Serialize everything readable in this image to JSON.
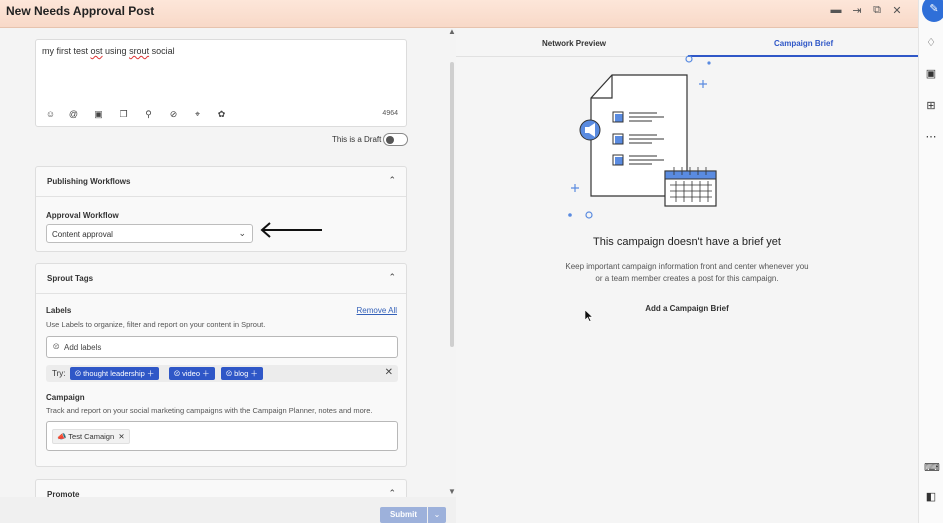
{
  "window": {
    "title": "New Needs Approval Post",
    "controls": [
      "minimize-icon",
      "dock-icon",
      "restore-icon",
      "close-icon"
    ]
  },
  "composer": {
    "text_parts": [
      "my first test ",
      "ost",
      " using ",
      "srout",
      " social"
    ],
    "char_count": "4964",
    "tools": [
      "emoji-icon",
      "mention-icon",
      "camera-icon",
      "media-library-icon",
      "location-icon",
      "hide-icon",
      "crop-icon",
      "assets-icon"
    ],
    "draft_label": "This is a Draft",
    "draft_on": false
  },
  "publishing": {
    "heading": "Publishing Workflows",
    "approval_label": "Approval Workflow",
    "approval_value": "Content approval"
  },
  "sprout_tags": {
    "heading": "Sprout Tags",
    "labels_title": "Labels",
    "remove_all": "Remove All",
    "labels_help": "Use Labels to organize, filter and report on your content in Sprout.",
    "labels_placeholder": "Add labels",
    "try_label": "Try:",
    "suggestions": [
      "thought leadership",
      "video",
      "blog"
    ],
    "campaign_title": "Campaign",
    "campaign_help": "Track and report on your social marketing campaigns with the Campaign Planner, notes and more.",
    "campaign_value": "Test Camaign"
  },
  "promote": {
    "heading": "Promote"
  },
  "footer": {
    "submit": "Submit"
  },
  "preview": {
    "tabs": [
      "Network Preview",
      "Campaign Brief"
    ],
    "active_tab": "Campaign Brief",
    "empty_title": "This campaign doesn't have a brief yet",
    "empty_desc_1": "Keep important campaign information front and center whenever you",
    "empty_desc_2": "or a team member creates a post for this campaign.",
    "add_brief": "Add a Campaign Brief"
  },
  "colors": {
    "accent": "#2f57c7",
    "titlebar": "#fde6d9",
    "submit_disabled": "#9db1db"
  }
}
